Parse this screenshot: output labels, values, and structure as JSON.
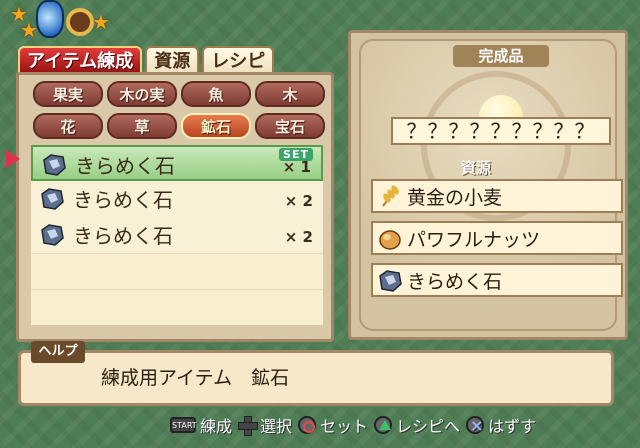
{
  "tabs": [
    "アイテム練成",
    "資源",
    "レシピ"
  ],
  "categories": [
    "果実",
    "木の実",
    "魚",
    "木",
    "花",
    "草",
    "鉱石",
    "宝石"
  ],
  "selected_category": "鉱石",
  "items": [
    {
      "name": "きらめく石",
      "qty": "× 1",
      "badge": "SET",
      "icon": "ore-stone-icon"
    },
    {
      "name": "きらめく石",
      "qty": "× 2",
      "badge": "",
      "icon": "ore-stone-icon"
    },
    {
      "name": "きらめく石",
      "qty": "× 2",
      "badge": "",
      "icon": "ore-stone-icon"
    }
  ],
  "right": {
    "title": "完成品",
    "product": "？？？？？？？？？",
    "resources_label": "資源",
    "resources": [
      {
        "name": "黄金の小麦",
        "icon": "wheat-icon"
      },
      {
        "name": "パワフルナッツ",
        "icon": "nut-icon"
      },
      {
        "name": "きらめく石",
        "icon": "ore-stone-icon"
      }
    ]
  },
  "help": {
    "tag": "ヘルプ",
    "text": "練成用アイテム　鉱石"
  },
  "controls": {
    "start_label": "START",
    "synth": "練成",
    "select": "選択",
    "set": "セット",
    "to_recipe": "レシピへ",
    "remove": "はずす"
  },
  "colors": {
    "accent": "#e23c3c",
    "selected_row": "#98cf86",
    "panel": "#d9c9a9"
  }
}
